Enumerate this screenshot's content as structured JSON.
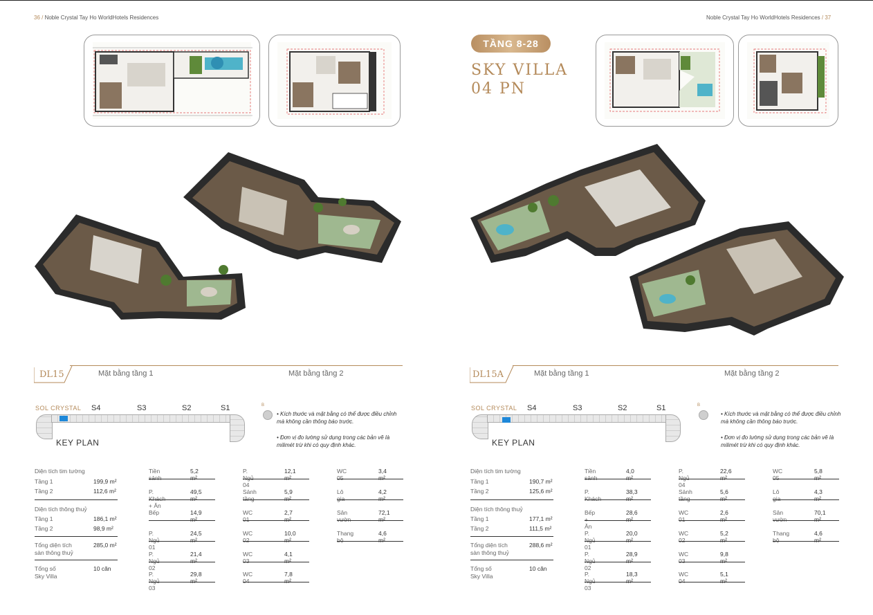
{
  "header": {
    "left_page_num": "36 /",
    "left_title": "Noble Crystal Tay Ho WorldHotels Residences",
    "right_title": "Noble Crystal Tay Ho WorldHotels Residences",
    "right_page_num": "/ 37"
  },
  "right_hero": {
    "badge": "TẦNG 8-28",
    "title_line1": "SKY VILLA",
    "title_line2": "04 PN"
  },
  "colors": {
    "accent": "#b48a5a",
    "keyplan_marker": "#1e88d9",
    "pool": "#4fb3c9",
    "garden": "#5f8a3a"
  },
  "left": {
    "code": "DL15",
    "floor1_label": "Mặt bằng tầng 1",
    "floor2_label": "Mặt bằng tầng 2",
    "keyplan": {
      "brand": "SOL CRYSTAL",
      "s4": "S4",
      "s3": "S3",
      "s2": "S2",
      "s1": "S1",
      "title": "KEY PLAN"
    },
    "notes": [
      "• Kích thước và mặt bằng có thể được điều chỉnh mà không cần thông báo trước.",
      "• Đơn vị đo lường sử dụng trong các bản vẽ là milimét trừ khi có quy định khác."
    ],
    "summary": {
      "tim_tuong_title": "Diện tích tim tường",
      "tt_t1_label": "Tầng 1",
      "tt_t1_val": "199,9 m²",
      "tt_t2_label": "Tầng 2",
      "tt_t2_val": "112,6 m²",
      "thong_thuy_title": "Diện tích thông thuỷ",
      "th_t1_label": "Tầng 1",
      "th_t1_val": "186,1 m²",
      "th_t2_label": "Tầng 2",
      "th_t2_val": "98,9 m²",
      "total_label1": "Tổng diện tích",
      "total_label2": "sàn thông thuỷ",
      "total_val": "285,0 m²",
      "count_label1": "Tổng số",
      "count_label2": "Sky Villa",
      "count_val": "10 căn"
    },
    "rooms": [
      {
        "label": "Tiền sảnh",
        "val": "5,2 m²"
      },
      {
        "label": "P. Khách + Ăn",
        "val": "49,5 m²"
      },
      {
        "label": "Bếp",
        "val": "14,9 m²"
      },
      {
        "label": "P. Ngủ 01",
        "val": "24,5 m²"
      },
      {
        "label": "P. Ngủ 02",
        "val": "21,4 m²"
      },
      {
        "label": "P. Ngủ 03",
        "val": "29,8 m²"
      },
      {
        "label": "P. Ngủ 04",
        "val": "12,1 m²"
      },
      {
        "label": "Sảnh tầng",
        "val": "5,9 m²"
      },
      {
        "label": "WC 01",
        "val": "2,7 m²"
      },
      {
        "label": "WC 02",
        "val": "10,0 m²"
      },
      {
        "label": "WC 03",
        "val": "4,1 m²"
      },
      {
        "label": "WC 04",
        "val": "7,8 m²"
      },
      {
        "label": "WC 05",
        "val": "3,4 m²"
      },
      {
        "label": "Lô gia",
        "val": "4,2 m²"
      },
      {
        "label": "Sân vườn",
        "val": "72,1 m²"
      },
      {
        "label": "Thang bộ",
        "val": "4,6 m²"
      }
    ]
  },
  "right": {
    "code": "DL15A",
    "floor1_label": "Mặt bằng tầng 1",
    "floor2_label": "Mặt bằng tầng 2",
    "keyplan": {
      "brand": "SOL CRYSTAL",
      "s4": "S4",
      "s3": "S3",
      "s2": "S2",
      "s1": "S1",
      "title": "KEY PLAN"
    },
    "notes": [
      "• Kích thước và mặt bằng có thể được điều chỉnh mà không cần thông báo trước.",
      "• Đơn vị đo lường sử dụng trong các bản vẽ là milimét trừ khi có quy định khác."
    ],
    "summary": {
      "tim_tuong_title": "Diện tích tim tường",
      "tt_t1_label": "Tầng 1",
      "tt_t1_val": "190,7 m²",
      "tt_t2_label": "Tầng 2",
      "tt_t2_val": "125,6 m²",
      "thong_thuy_title": "Diện tích thông thuỷ",
      "th_t1_label": "Tầng 1",
      "th_t1_val": "177,1 m²",
      "th_t2_label": "Tầng 2",
      "th_t2_val": "111,5 m²",
      "total_label1": "Tổng diện tích",
      "total_label2": "sàn thông thuỷ",
      "total_val": "288,6 m²",
      "count_label1": "Tổng số",
      "count_label2": "Sky Villa",
      "count_val": "10 căn"
    },
    "rooms": [
      {
        "label": "Tiền sảnh",
        "val": "4,0 m²"
      },
      {
        "label": "P. Khách",
        "val": "38,3 m²"
      },
      {
        "label": "Bếp + Ăn",
        "val": "28,6 m²"
      },
      {
        "label": "P. Ngủ 01",
        "val": "20,0 m²"
      },
      {
        "label": "P. Ngủ 02",
        "val": "28,9 m²"
      },
      {
        "label": "P. Ngủ 03",
        "val": "18,3 m²"
      },
      {
        "label": "P. Ngủ 04",
        "val": "22,6 m²"
      },
      {
        "label": "Sảnh tầng",
        "val": "5,6 m²"
      },
      {
        "label": "WC 01",
        "val": "2,6 m²"
      },
      {
        "label": "WC 02",
        "val": "5,2 m²"
      },
      {
        "label": "WC 03",
        "val": "9,8 m²"
      },
      {
        "label": "WC 04",
        "val": "5,1 m²"
      },
      {
        "label": "WC 05",
        "val": "5,8 m²"
      },
      {
        "label": "Lô gia",
        "val": "4,3 m²"
      },
      {
        "label": "Sân vườn",
        "val": "70,1 m²"
      },
      {
        "label": "Thang bộ",
        "val": "4,6 m²"
      }
    ]
  }
}
